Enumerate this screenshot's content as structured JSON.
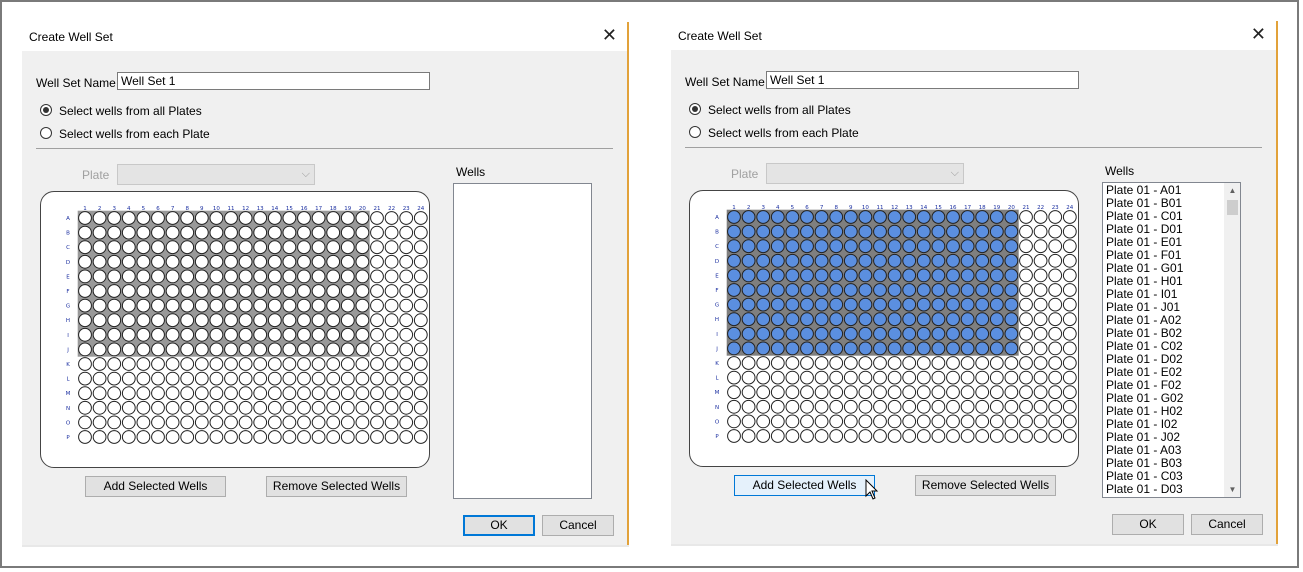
{
  "colors": {
    "well_selected": "#5b8fe0",
    "well_highlight": "#999999",
    "well_empty": "#ffffff",
    "axis_label": "#1a2ea0"
  },
  "plate_layout": {
    "rows": [
      "A",
      "B",
      "C",
      "D",
      "E",
      "F",
      "G",
      "H",
      "I",
      "J",
      "K",
      "L",
      "M",
      "N",
      "O",
      "P"
    ],
    "columns": [
      "1",
      "2",
      "3",
      "4",
      "5",
      "6",
      "7",
      "8",
      "9",
      "10",
      "11",
      "12",
      "13",
      "14",
      "15",
      "16",
      "17",
      "18",
      "19",
      "20",
      "21",
      "22",
      "23",
      "24"
    ]
  },
  "dialogs": [
    {
      "title": "Create Well Set",
      "well_set_name_label": "Well Set Name",
      "well_set_name_value": "Well Set 1",
      "radio_all": "Select wells from all Plates",
      "radio_each": "Select wells from each Plate",
      "selected_radio": "all",
      "plate_label": "Plate",
      "plate_value": "",
      "wells_label": "Wells",
      "wells_list": [],
      "add_button": "Add Selected Wells",
      "remove_button": "Remove Selected Wells",
      "ok_button": "OK",
      "cancel_button": "Cancel",
      "selection": {
        "rows": 10,
        "cols": 20,
        "state": "highlighted"
      }
    },
    {
      "title": "Create Well Set",
      "well_set_name_label": "Well Set Name",
      "well_set_name_value": "Well Set 1",
      "radio_all": "Select wells from all Plates",
      "radio_each": "Select wells from each Plate",
      "selected_radio": "all",
      "plate_label": "Plate",
      "plate_value": "",
      "wells_label": "Wells",
      "wells_list": [
        "Plate 01 - A01",
        "Plate 01 - B01",
        "Plate 01 - C01",
        "Plate 01 - D01",
        "Plate 01 - E01",
        "Plate 01 - F01",
        "Plate 01 - G01",
        "Plate 01 - H01",
        "Plate 01 - I01",
        "Plate 01 - J01",
        "Plate 01 - A02",
        "Plate 01 - B02",
        "Plate 01 - C02",
        "Plate 01 - D02",
        "Plate 01 - E02",
        "Plate 01 - F02",
        "Plate 01 - G02",
        "Plate 01 - H02",
        "Plate 01 - I02",
        "Plate 01 - J02",
        "Plate 01 - A03",
        "Plate 01 - B03",
        "Plate 01 - C03",
        "Plate 01 - D03"
      ],
      "add_button": "Add Selected Wells",
      "remove_button": "Remove Selected Wells",
      "ok_button": "OK",
      "cancel_button": "Cancel",
      "selection": {
        "rows": 10,
        "cols": 20,
        "state": "added"
      }
    }
  ]
}
